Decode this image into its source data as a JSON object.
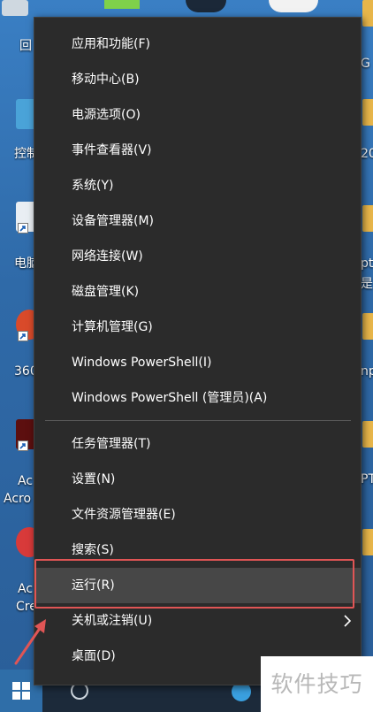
{
  "desktop": {
    "left_labels": [
      "回",
      "控制",
      "电脑",
      "360",
      "Ac",
      "Acro",
      "Ac",
      "Cre"
    ],
    "right_labels": [
      "G",
      "20",
      "pt",
      "是",
      "np",
      "PT"
    ]
  },
  "menu": {
    "group1": [
      {
        "label": "应用和功能(F)"
      },
      {
        "label": "移动中心(B)"
      },
      {
        "label": "电源选项(O)"
      },
      {
        "label": "事件查看器(V)"
      },
      {
        "label": "系统(Y)"
      },
      {
        "label": "设备管理器(M)"
      },
      {
        "label": "网络连接(W)"
      },
      {
        "label": "磁盘管理(K)"
      },
      {
        "label": "计算机管理(G)"
      },
      {
        "label": "Windows PowerShell(I)"
      },
      {
        "label": "Windows PowerShell (管理员)(A)"
      }
    ],
    "group2": [
      {
        "label": "任务管理器(T)"
      },
      {
        "label": "设置(N)"
      },
      {
        "label": "文件资源管理器(E)"
      },
      {
        "label": "搜索(S)"
      },
      {
        "label": "运行(R)",
        "highlighted": true
      },
      {
        "label": "关机或注销(U)",
        "has_submenu": true
      },
      {
        "label": "桌面(D)"
      }
    ]
  },
  "watermark": {
    "text": "软件技巧"
  },
  "colors": {
    "menu_bg": "#2b2b2b",
    "menu_highlight": "#474747",
    "annotation_red": "#e05555",
    "desktop_blue": "#2f6aa8"
  }
}
